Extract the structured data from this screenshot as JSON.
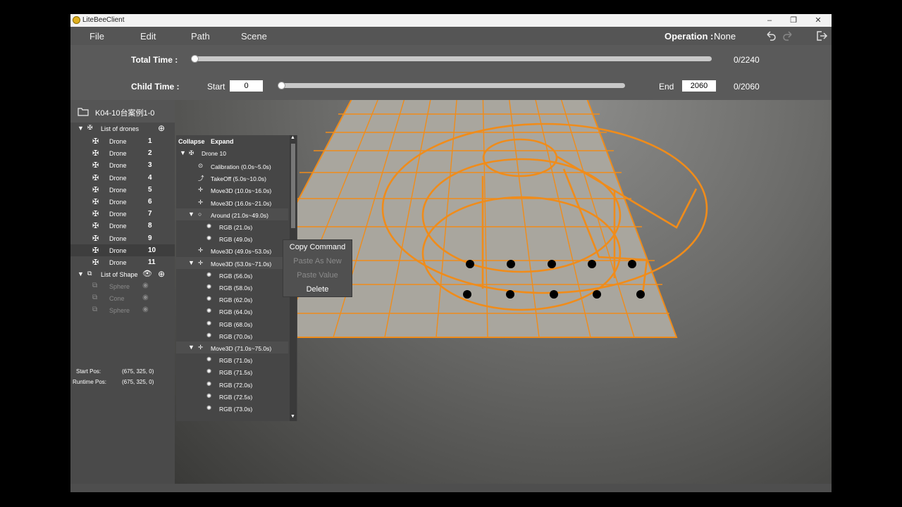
{
  "window": {
    "title": "LiteBeeClient",
    "controls": [
      "–",
      "❐",
      "✕"
    ]
  },
  "menu": {
    "items": [
      "File",
      "Edit",
      "Path",
      "Scene"
    ],
    "operation_label": "Operation :",
    "operation_value": "None"
  },
  "timeline": {
    "total_label": "Total Time :",
    "total_readout": "0/2240",
    "total_progress": 0,
    "child_label": "Child Time :",
    "start_label": "Start",
    "start_value": "0",
    "end_label": "End",
    "end_value": "2060",
    "child_readout": "0/2060",
    "child_progress": 0
  },
  "project": {
    "name": "K04-10台案例1-0"
  },
  "drones": {
    "header": "List of drones",
    "items": [
      {
        "label": "Drone",
        "num": "1"
      },
      {
        "label": "Drone",
        "num": "2"
      },
      {
        "label": "Drone",
        "num": "3"
      },
      {
        "label": "Drone",
        "num": "4"
      },
      {
        "label": "Drone",
        "num": "5"
      },
      {
        "label": "Drone",
        "num": "6"
      },
      {
        "label": "Drone",
        "num": "7"
      },
      {
        "label": "Drone",
        "num": "8"
      },
      {
        "label": "Drone",
        "num": "9"
      },
      {
        "label": "Drone",
        "num": "10",
        "selected": true
      },
      {
        "label": "Drone",
        "num": "11"
      }
    ]
  },
  "shapes": {
    "header": "List of Shape",
    "items": [
      "Sphere",
      "Cone",
      "Sphere"
    ]
  },
  "positions": {
    "start_label": "Start Pos:",
    "start_value": "(675, 325, 0)",
    "runtime_label": "Runtime Pos:",
    "runtime_value": "(675, 325, 0)"
  },
  "commands": {
    "collapse": "Collapse",
    "expand": "Expand",
    "root": "Drone 10",
    "rows": [
      {
        "level": 1,
        "icon": "calibration-icon",
        "text": "Calibration (0.0s~5.0s)"
      },
      {
        "level": 1,
        "icon": "takeoff-icon",
        "text": "TakeOff (5.0s~10.0s)"
      },
      {
        "level": 1,
        "icon": "move-icon",
        "text": "Move3D (10.0s~16.0s)"
      },
      {
        "level": 1,
        "icon": "move-icon",
        "text": "Move3D (16.0s~21.0s)"
      },
      {
        "level": 1,
        "icon": "around-icon",
        "text": "Around (21.0s~49.0s)",
        "expanded": true
      },
      {
        "level": 2,
        "icon": "palette-icon",
        "text": "RGB (21.0s)"
      },
      {
        "level": 2,
        "icon": "palette-icon",
        "text": "RGB (49.0s)"
      },
      {
        "level": 1,
        "icon": "move-icon",
        "text": "Move3D (49.0s~53.0s)"
      },
      {
        "level": 1,
        "icon": "move-icon",
        "text": "Move3D (53.0s~71.0s)",
        "expanded": true
      },
      {
        "level": 2,
        "icon": "palette-icon",
        "text": "RGB (56.0s)"
      },
      {
        "level": 2,
        "icon": "palette-icon",
        "text": "RGB (58.0s)"
      },
      {
        "level": 2,
        "icon": "palette-icon",
        "text": "RGB (62.0s)"
      },
      {
        "level": 2,
        "icon": "palette-icon",
        "text": "RGB (64.0s)"
      },
      {
        "level": 2,
        "icon": "palette-icon",
        "text": "RGB (68.0s)"
      },
      {
        "level": 2,
        "icon": "palette-icon",
        "text": "RGB (70.0s)"
      },
      {
        "level": 1,
        "icon": "move-icon",
        "text": "Move3D (71.0s~75.0s)",
        "expanded": true
      },
      {
        "level": 2,
        "icon": "palette-icon",
        "text": "RGB (71.0s)"
      },
      {
        "level": 2,
        "icon": "palette-icon",
        "text": "RGB (71.5s)"
      },
      {
        "level": 2,
        "icon": "palette-icon",
        "text": "RGB (72.0s)"
      },
      {
        "level": 2,
        "icon": "palette-icon",
        "text": "RGB (72.5s)"
      },
      {
        "level": 2,
        "icon": "palette-icon",
        "text": "RGB (73.0s)"
      }
    ]
  },
  "context_menu": {
    "items": [
      {
        "label": "Copy Command",
        "enabled": true
      },
      {
        "label": "Paste As New",
        "enabled": false
      },
      {
        "label": "Paste Value",
        "enabled": false
      },
      {
        "label": "Delete",
        "enabled": true
      }
    ]
  },
  "colors": {
    "path": "#f08c1a",
    "grid_floor": "#a9a69e",
    "drone": "#000000"
  }
}
